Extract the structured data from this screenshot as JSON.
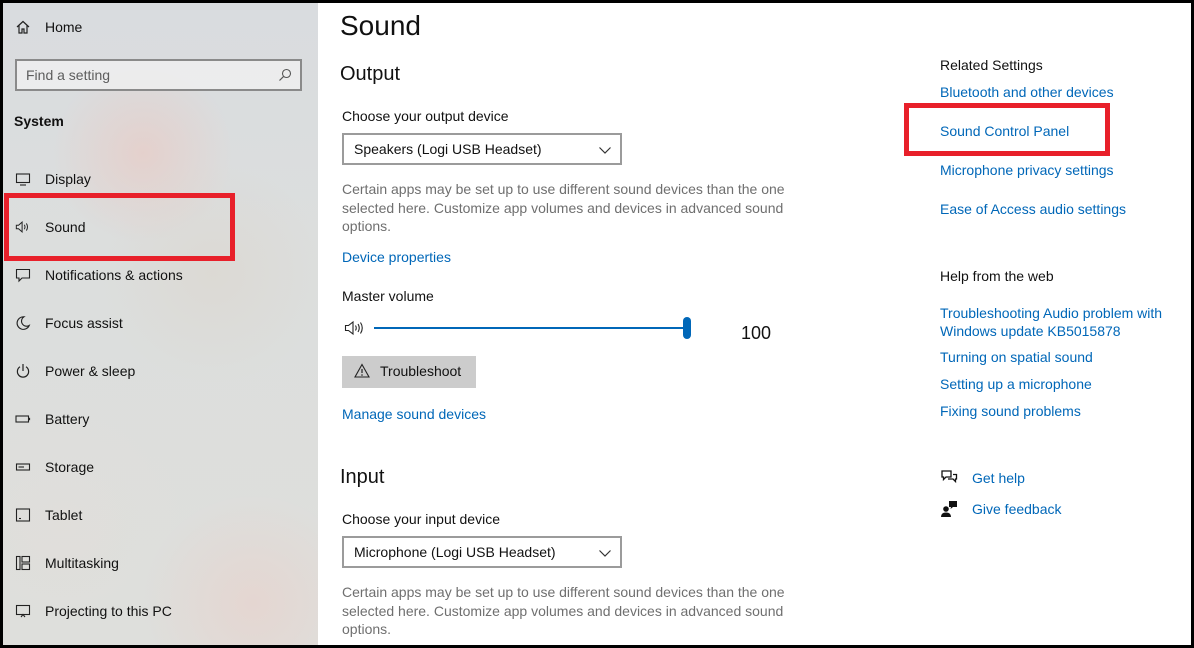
{
  "sidebar": {
    "home_label": "Home",
    "search_placeholder": "Find a setting",
    "section_label": "System",
    "items": [
      {
        "label": "Display",
        "icon": "monitor-icon"
      },
      {
        "label": "Sound",
        "icon": "speaker-icon"
      },
      {
        "label": "Notifications & actions",
        "icon": "notification-icon"
      },
      {
        "label": "Focus assist",
        "icon": "moon-icon"
      },
      {
        "label": "Power & sleep",
        "icon": "power-icon"
      },
      {
        "label": "Battery",
        "icon": "battery-icon"
      },
      {
        "label": "Storage",
        "icon": "storage-icon"
      },
      {
        "label": "Tablet",
        "icon": "tablet-icon"
      },
      {
        "label": "Multitasking",
        "icon": "multitasking-icon"
      },
      {
        "label": "Projecting to this PC",
        "icon": "projector-icon"
      }
    ]
  },
  "main": {
    "title": "Sound",
    "output": {
      "heading": "Output",
      "choose_label": "Choose your output device",
      "device_value": "Speakers (Logi USB Headset)",
      "description": "Certain apps may be set up to use different sound devices than the one selected here. Customize app volumes and devices in advanced sound options.",
      "device_properties_link": "Device properties",
      "master_volume_label": "Master volume",
      "volume_value": "100",
      "volume_level": 1.0,
      "troubleshoot_label": "Troubleshoot",
      "manage_link": "Manage sound devices"
    },
    "input": {
      "heading": "Input",
      "choose_label": "Choose your input device",
      "device_value": "Microphone (Logi USB Headset)",
      "description": "Certain apps may be set up to use different sound devices than the one selected here. Customize app volumes and devices in advanced sound options."
    }
  },
  "related": {
    "heading": "Related Settings",
    "links": [
      "Bluetooth and other devices",
      "Sound Control Panel",
      "Microphone privacy settings",
      "Ease of Access audio settings"
    ]
  },
  "help_web": {
    "heading": "Help from the web",
    "link1_line1": "Troubleshooting Audio problem with",
    "link1_line2": "Windows update KB5015878",
    "links": [
      "Turning on spatial sound",
      "Setting up a microphone",
      "Fixing sound problems"
    ]
  },
  "support": {
    "get_help": "Get help",
    "give_feedback": "Give feedback"
  },
  "colors": {
    "accent": "#0067b8",
    "highlight": "#e8202a"
  }
}
